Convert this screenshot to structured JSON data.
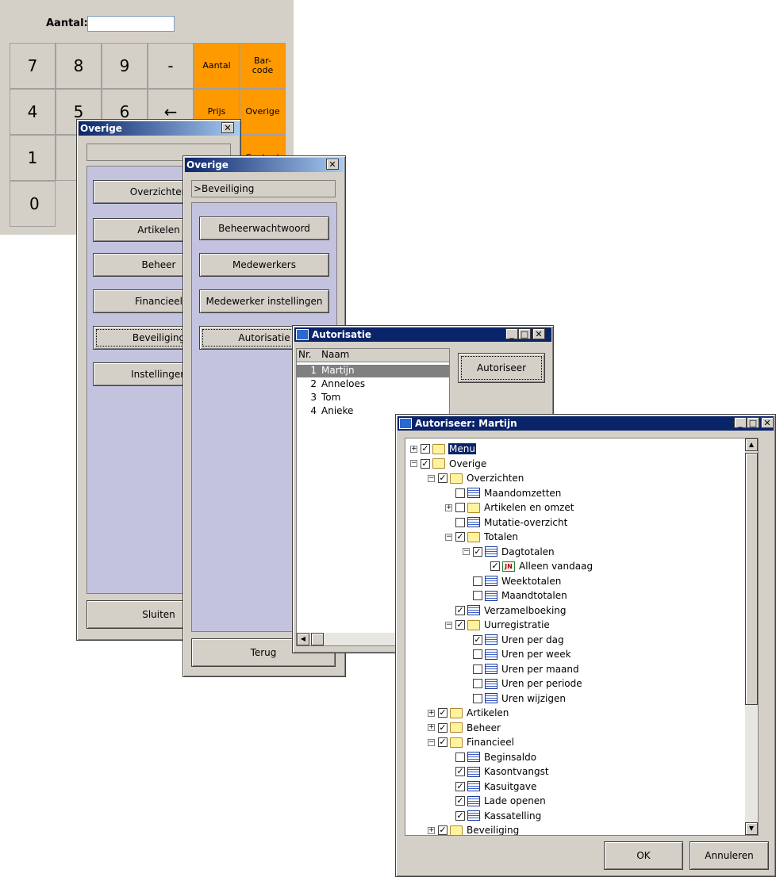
{
  "keypad": {
    "qty_label": "Aantal:",
    "qty_value": "",
    "keys": [
      "7",
      "8",
      "9",
      "-",
      "4",
      "5",
      "6",
      "←",
      "1",
      "",
      "0"
    ],
    "orange": [
      "Aantal",
      "Bar-\ncode",
      "Prijs",
      "Overige",
      "Contant"
    ]
  },
  "win1": {
    "title": "Overige",
    "path": "",
    "buttons": [
      "Overzichten",
      "Artikelen",
      "Beheer",
      "Financieel",
      "Beveiliging",
      "Instellingen"
    ],
    "close": "Sluiten"
  },
  "win2": {
    "title": "Overige",
    "path": ">Beveiliging",
    "buttons": [
      "Beheerwachtwoord",
      "Medewerkers",
      "Medewerker instellingen",
      "Autorisatie"
    ],
    "back": "Terug"
  },
  "win3": {
    "title": "Autorisatie",
    "col_nr": "Nr.",
    "col_name": "Naam",
    "rows": [
      {
        "nr": "1",
        "name": "Martijn"
      },
      {
        "nr": "2",
        "name": "Anneloes"
      },
      {
        "nr": "3",
        "name": "Tom"
      },
      {
        "nr": "4",
        "name": "Anieke"
      }
    ],
    "authorize": "Autoriseer"
  },
  "win4": {
    "title": "Autoriseer: Martijn",
    "ok": "OK",
    "cancel": "Annuleren",
    "tree": [
      {
        "label": "Menu",
        "lvl": 0,
        "exp": "+",
        "chk": true,
        "icon": "folder",
        "hl": true
      },
      {
        "label": "Overige",
        "lvl": 0,
        "exp": "-",
        "chk": true,
        "icon": "folder"
      },
      {
        "label": "Overzichten",
        "lvl": 1,
        "exp": "-",
        "chk": true,
        "icon": "folder"
      },
      {
        "label": "Maandomzetten",
        "lvl": 2,
        "exp": "",
        "chk": false,
        "icon": "grid"
      },
      {
        "label": "Artikelen en omzet",
        "lvl": 2,
        "exp": "+",
        "chk": false,
        "icon": "folder"
      },
      {
        "label": "Mutatie-overzicht",
        "lvl": 2,
        "exp": "",
        "chk": false,
        "icon": "grid"
      },
      {
        "label": "Totalen",
        "lvl": 2,
        "exp": "-",
        "chk": true,
        "icon": "folder"
      },
      {
        "label": "Dagtotalen",
        "lvl": 3,
        "exp": "-",
        "chk": true,
        "icon": "grid"
      },
      {
        "label": "Alleen vandaag",
        "lvl": 4,
        "exp": "",
        "chk": true,
        "icon": "rep"
      },
      {
        "label": "Weektotalen",
        "lvl": 3,
        "exp": "",
        "chk": false,
        "icon": "grid"
      },
      {
        "label": "Maandtotalen",
        "lvl": 3,
        "exp": "",
        "chk": false,
        "icon": "grid"
      },
      {
        "label": "Verzamelboeking",
        "lvl": 2,
        "exp": "",
        "chk": true,
        "icon": "grid"
      },
      {
        "label": "Uurregistratie",
        "lvl": 2,
        "exp": "-",
        "chk": true,
        "icon": "folder"
      },
      {
        "label": "Uren per dag",
        "lvl": 3,
        "exp": "",
        "chk": true,
        "icon": "grid"
      },
      {
        "label": "Uren per week",
        "lvl": 3,
        "exp": "",
        "chk": false,
        "icon": "grid"
      },
      {
        "label": "Uren per maand",
        "lvl": 3,
        "exp": "",
        "chk": false,
        "icon": "grid"
      },
      {
        "label": "Uren per periode",
        "lvl": 3,
        "exp": "",
        "chk": false,
        "icon": "grid"
      },
      {
        "label": "Uren wijzigen",
        "lvl": 3,
        "exp": "",
        "chk": false,
        "icon": "grid"
      },
      {
        "label": "Artikelen",
        "lvl": 1,
        "exp": "+",
        "chk": true,
        "icon": "folder"
      },
      {
        "label": "Beheer",
        "lvl": 1,
        "exp": "+",
        "chk": true,
        "icon": "folder"
      },
      {
        "label": "Financieel",
        "lvl": 1,
        "exp": "-",
        "chk": true,
        "icon": "folder"
      },
      {
        "label": "Beginsaldo",
        "lvl": 2,
        "exp": "",
        "chk": false,
        "icon": "grid"
      },
      {
        "label": "Kasontvangst",
        "lvl": 2,
        "exp": "",
        "chk": true,
        "icon": "grid"
      },
      {
        "label": "Kasuitgave",
        "lvl": 2,
        "exp": "",
        "chk": true,
        "icon": "grid"
      },
      {
        "label": "Lade openen",
        "lvl": 2,
        "exp": "",
        "chk": true,
        "icon": "grid"
      },
      {
        "label": "Kassatelling",
        "lvl": 2,
        "exp": "",
        "chk": true,
        "icon": "grid"
      },
      {
        "label": "Beveiliging",
        "lvl": 1,
        "exp": "+",
        "chk": true,
        "icon": "folder"
      }
    ]
  }
}
